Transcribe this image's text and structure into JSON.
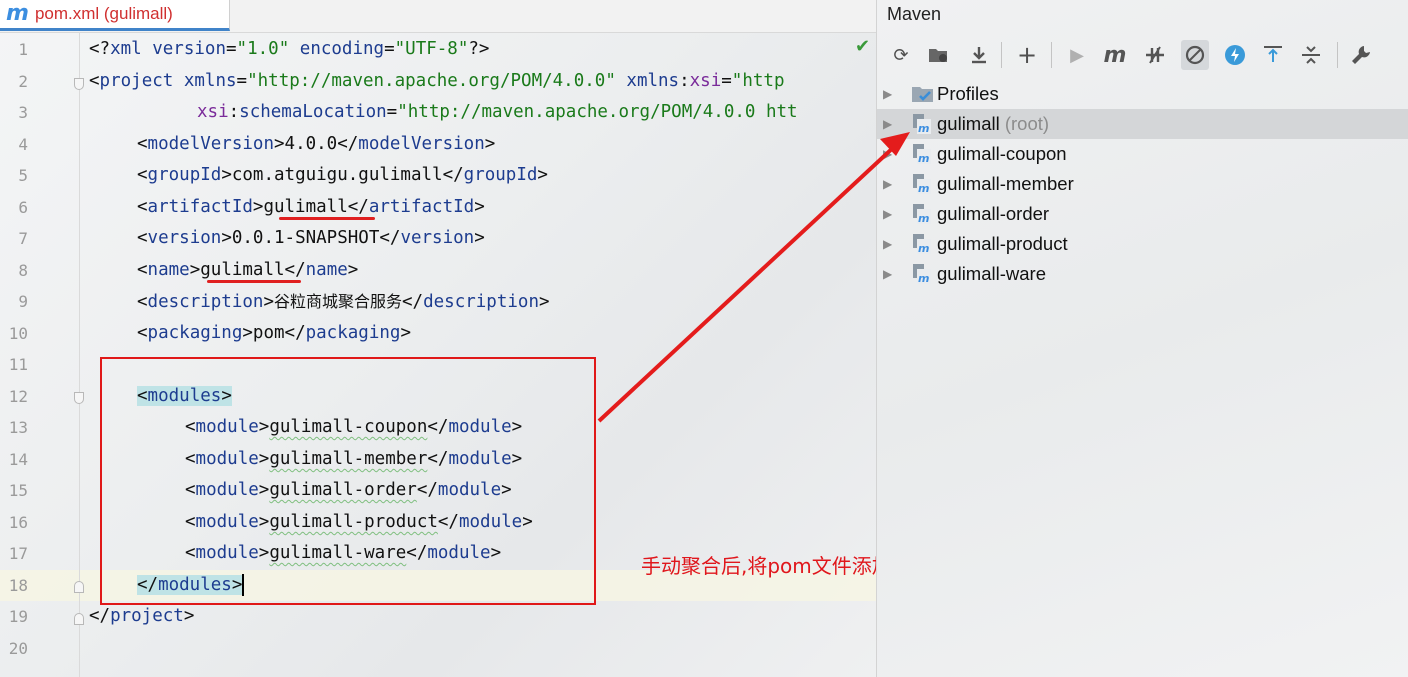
{
  "editor": {
    "tab_title": "pom.xml (gulimall)",
    "line_numbers": [
      "1",
      "2",
      "3",
      "4",
      "5",
      "6",
      "7",
      "8",
      "9",
      "10",
      "11",
      "12",
      "13",
      "14",
      "15",
      "16",
      "17",
      "18",
      "19",
      "20"
    ],
    "code": {
      "l1": {
        "a": "<?",
        "b": "xml ",
        "c": "version",
        "d": "=",
        "e": "\"1.0\"",
        "f": " ",
        "g": "encoding",
        "h": "=",
        "i": "\"UTF-8\"",
        "j": "?>"
      },
      "l2": {
        "a": "<",
        "b": "project",
        "c": " ",
        "d": "xmlns",
        "e": "=",
        "f": "\"http://maven.apache.org/POM/4.0.0\"",
        "g": " ",
        "h": "xmlns",
        "i": ":",
        "j": "xsi",
        "k": "=",
        "l": "\"http"
      },
      "l3": {
        "a": "xsi",
        "b": ":",
        "c": "schemaLocation",
        "d": "=",
        "e": "\"http://maven.apache.org/POM/4.0.0 htt"
      },
      "l4": {
        "open": "modelVersion",
        "value": "4.0.0",
        "close": "modelVersion"
      },
      "l5": {
        "open": "groupId",
        "value": "com.atguigu.gulimall",
        "close": "groupId"
      },
      "l6": {
        "open": "artifactId",
        "value": "gulimall",
        "close": "artifactId"
      },
      "l7": {
        "open": "version",
        "value": "0.0.1-SNAPSHOT",
        "close": "version"
      },
      "l8": {
        "open": "name",
        "value": "gulimall",
        "close": "name"
      },
      "l9": {
        "open": "description",
        "value": "谷粒商城聚合服务",
        "close": "description"
      },
      "l10": {
        "open": "packaging",
        "value": "pom",
        "close": "packaging"
      },
      "l12": {
        "tag": "modules"
      },
      "modules": [
        {
          "open": "module",
          "value": "gulimall-coupon",
          "close": "module"
        },
        {
          "open": "module",
          "value": "gulimall-member",
          "close": "module"
        },
        {
          "open": "module",
          "value": "gulimall-order",
          "close": "module"
        },
        {
          "open": "module",
          "value": "gulimall-product",
          "close": "module"
        },
        {
          "open": "module",
          "value": "gulimall-ware",
          "close": "module"
        }
      ],
      "l18": {
        "tag": "modules"
      },
      "l19": {
        "tag": "project"
      }
    },
    "annotation": "手动聚合后,将pom文件添加到Maven进行管理"
  },
  "maven": {
    "title": "Maven",
    "toolbar_icons": [
      "reload-icon",
      "add-folder-icon",
      "download-icon",
      "plus-icon",
      "run-icon",
      "maven-goal-icon",
      "toggle-offline-icon",
      "skip-tests-icon",
      "show-dependencies-icon",
      "expand-all-icon",
      "collapse-all-icon",
      "settings-wrench-icon"
    ],
    "tree": [
      {
        "label": "Profiles",
        "suffix": ""
      },
      {
        "label": "gulimall",
        "suffix": " (root)"
      },
      {
        "label": "gulimall-coupon",
        "suffix": ""
      },
      {
        "label": "gulimall-member",
        "suffix": ""
      },
      {
        "label": "gulimall-order",
        "suffix": ""
      },
      {
        "label": "gulimall-product",
        "suffix": ""
      },
      {
        "label": "gulimall-ware",
        "suffix": ""
      }
    ]
  },
  "colors": {
    "annotation_red": "#e0161c",
    "tag_blue": "#1d3c8f",
    "string_green": "#1a7a1a",
    "maven_blue": "#3c8ee0"
  }
}
